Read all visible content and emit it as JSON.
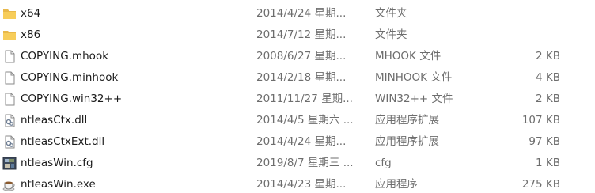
{
  "files": [
    {
      "name": "x64",
      "modified": "2014/4/24 星期...",
      "type": "文件夹",
      "size": "",
      "icon": "folder-icon"
    },
    {
      "name": "x86",
      "modified": "2014/7/12 星期...",
      "type": "文件夹",
      "size": "",
      "icon": "folder-icon"
    },
    {
      "name": "COPYING.mhook",
      "modified": "2008/6/27 星期...",
      "type": "MHOOK 文件",
      "size": "2 KB",
      "icon": "file-icon"
    },
    {
      "name": "COPYING.minhook",
      "modified": "2014/2/18 星期...",
      "type": "MINHOOK 文件",
      "size": "4 KB",
      "icon": "file-icon"
    },
    {
      "name": "COPYING.win32++",
      "modified": "2011/11/27 星期...",
      "type": "WIN32++ 文件",
      "size": "2 KB",
      "icon": "file-icon"
    },
    {
      "name": "ntleasCtx.dll",
      "modified": "2014/4/5 星期六 ...",
      "type": "应用程序扩展",
      "size": "107 KB",
      "icon": "dll-icon"
    },
    {
      "name": "ntleasCtxExt.dll",
      "modified": "2014/4/24 星期...",
      "type": "应用程序扩展",
      "size": "97 KB",
      "icon": "dll-icon"
    },
    {
      "name": "ntleasWin.cfg",
      "modified": "2019/8/7 星期三 ...",
      "type": "cfg",
      "size": "1 KB",
      "icon": "config-file-icon"
    },
    {
      "name": "ntleasWin.exe",
      "modified": "2014/4/23 星期...",
      "type": "应用程序",
      "size": "275 KB",
      "icon": "teacup-app-icon"
    }
  ]
}
